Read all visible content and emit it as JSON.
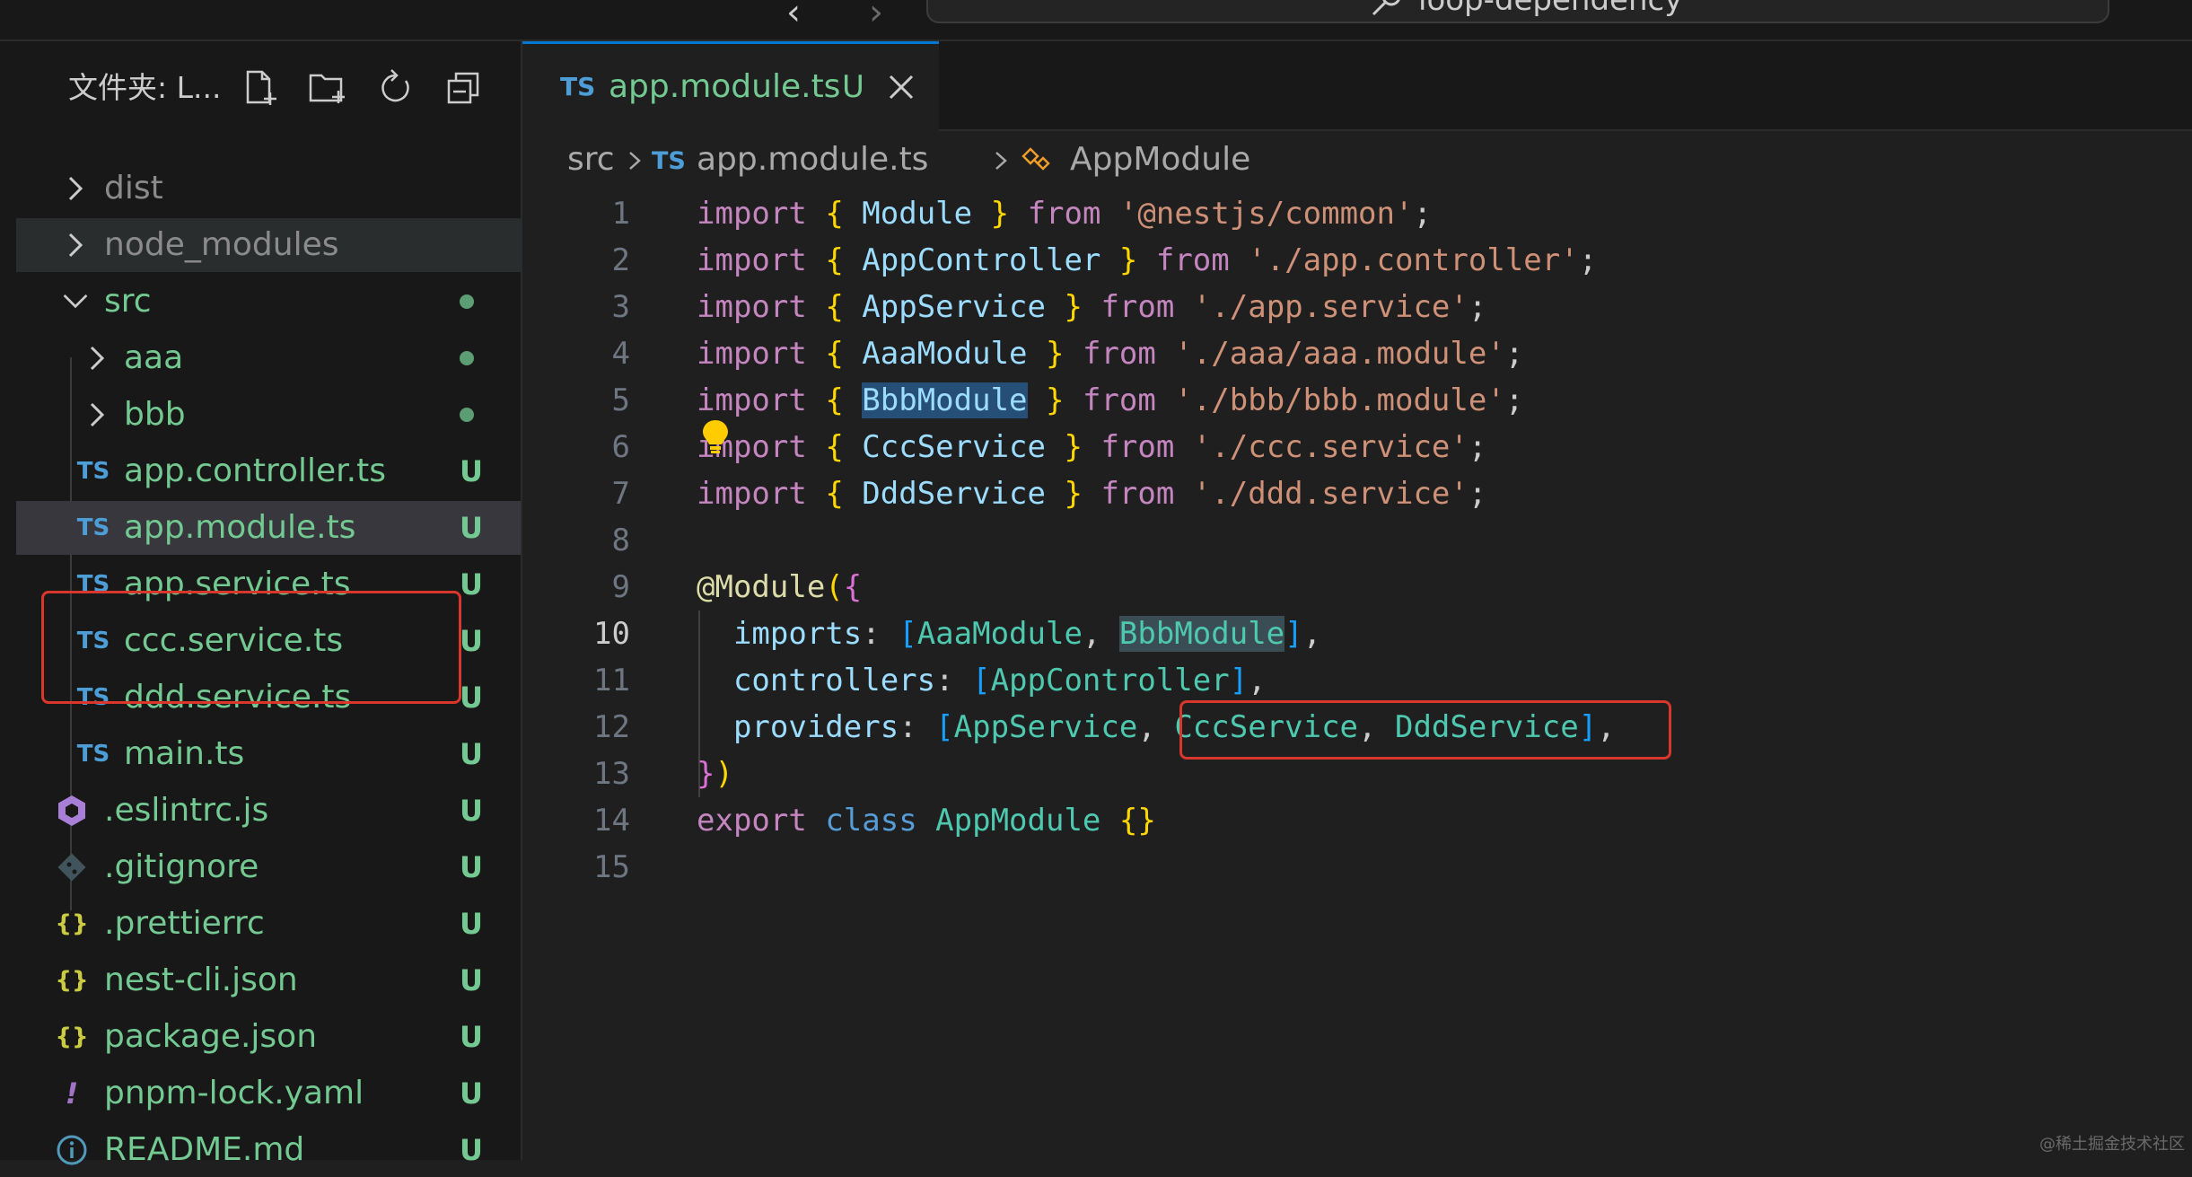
{
  "command_center": {
    "search_text": "loop-dependency"
  },
  "sidebar": {
    "title": "文件夹: L...",
    "actions": [
      "new-file",
      "new-folder",
      "refresh",
      "collapse-all"
    ],
    "tree": [
      {
        "name": "dist",
        "kind": "folder",
        "expanded": false,
        "status": ""
      },
      {
        "name": "node_modules",
        "kind": "folder",
        "expanded": false,
        "status": ""
      },
      {
        "name": "src",
        "kind": "folder",
        "expanded": true,
        "status": "dot"
      },
      {
        "name": "aaa",
        "kind": "folder",
        "expanded": false,
        "status": "dot"
      },
      {
        "name": "bbb",
        "kind": "folder",
        "expanded": false,
        "status": "dot"
      },
      {
        "name": "app.controller.ts",
        "kind": "ts",
        "icon": "TS",
        "status": "U"
      },
      {
        "name": "app.module.ts",
        "kind": "ts",
        "icon": "TS",
        "status": "U"
      },
      {
        "name": "app.service.ts",
        "kind": "ts",
        "icon": "TS",
        "status": "U"
      },
      {
        "name": "ccc.service.ts",
        "kind": "ts",
        "icon": "TS",
        "status": "U"
      },
      {
        "name": "ddd.service.ts",
        "kind": "ts",
        "icon": "TS",
        "status": "U"
      },
      {
        "name": "main.ts",
        "kind": "ts",
        "icon": "TS",
        "status": "U"
      },
      {
        "name": ".eslintrc.js",
        "kind": "eslint",
        "status": "U"
      },
      {
        "name": ".gitignore",
        "kind": "git",
        "status": "U"
      },
      {
        "name": ".prettierrc",
        "kind": "json",
        "icon": "{}",
        "status": "U"
      },
      {
        "name": "nest-cli.json",
        "kind": "json",
        "icon": "{}",
        "status": "U"
      },
      {
        "name": "package.json",
        "kind": "json",
        "icon": "{}",
        "status": "U"
      },
      {
        "name": "pnpm-lock.yaml",
        "kind": "yaml",
        "icon": "!",
        "status": "U"
      },
      {
        "name": "README.md",
        "kind": "info",
        "status": "U"
      }
    ]
  },
  "tab": {
    "icon": "TS",
    "label": "app.module.ts",
    "badge": "U"
  },
  "breadcrumb": {
    "folder": "src",
    "file_icon": "TS",
    "file": "app.module.ts",
    "symbol": "AppModule"
  },
  "code": {
    "active_line": 10,
    "lines": [
      "import { Module } from '@nestjs/common';",
      "import { AppController } from './app.controller';",
      "import { AppService } from './app.service';",
      "import { AaaModule } from './aaa/aaa.module';",
      "import { BbbModule } from './bbb/bbb.module';",
      "import { CccService } from './ccc.service';",
      "import { DddService } from './ddd.service';",
      "",
      "@Module({",
      "  imports: [AaaModule, BbbModule],",
      "  controllers: [AppController],",
      "  providers: [AppService, CccService, DddService],",
      "})",
      "export class AppModule {}",
      ""
    ]
  },
  "colors": {
    "accent": "#0078d4",
    "untracked": "#73c991",
    "highlight_box": "#d9372b"
  },
  "watermark": "@稀土掘金技术社区"
}
